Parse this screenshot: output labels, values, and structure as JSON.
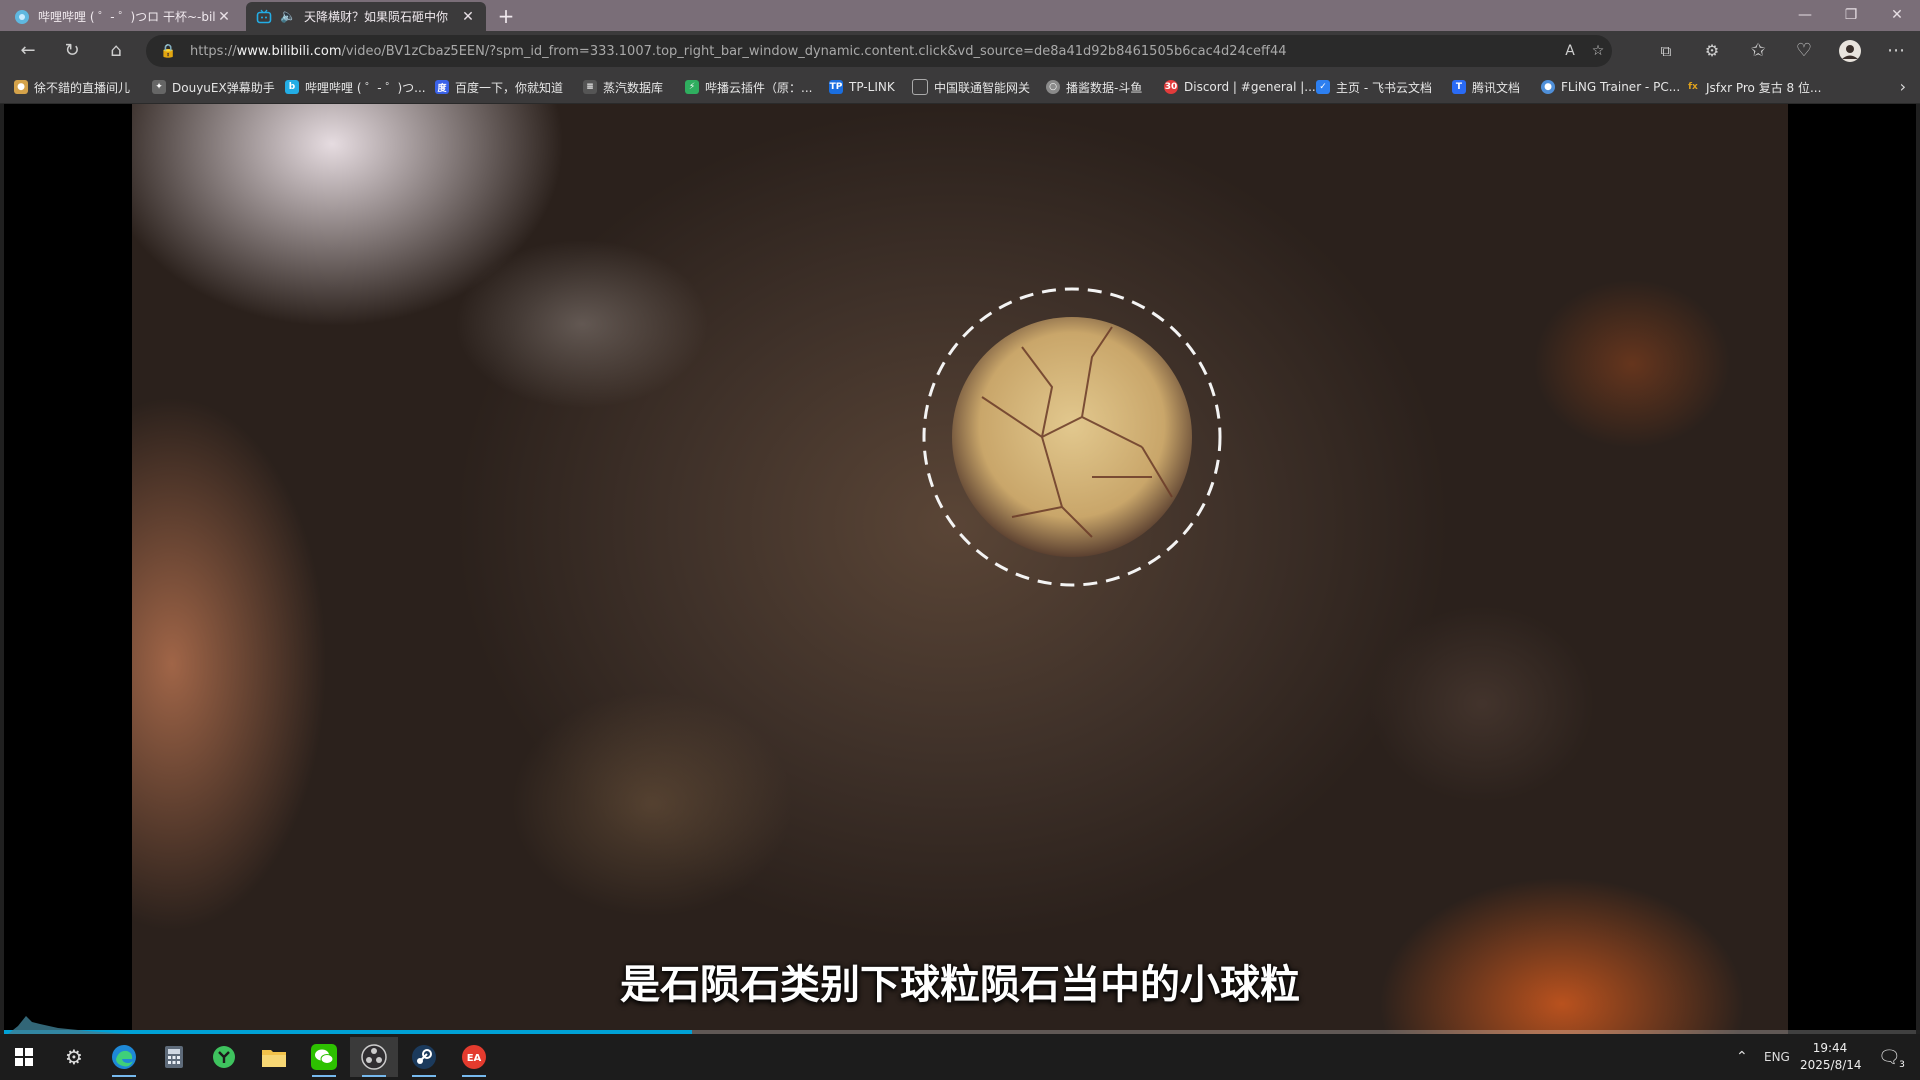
{
  "browser": {
    "tabs": [
      {
        "label": "哔哩哔哩 ( ゜- ゜)つロ 干杯~-bili",
        "active": false
      },
      {
        "label": "天降横财？如果陨石砸中你",
        "active": true
      }
    ],
    "url_prefix": "https://",
    "url_domain": "www.bilibili.com",
    "url_rest": "/video/BV1zCbaz5EEN/?spm_id_from=333.1007.top_right_bar_window_dynamic.content.click&vd_source=de8a41d92b8461505b6cac4d24ceff44"
  },
  "bookmarks": [
    {
      "label": "徐不錯的直播间儿",
      "icon": "avatar-icon",
      "color": "#d4a24a"
    },
    {
      "label": "DouyuEX弹幕助手",
      "icon": "puzzle-icon",
      "color": "#888888"
    },
    {
      "label": "哔哩哔哩 ( ゜- ゜)つ...",
      "icon": "bilibili-icon",
      "color": "#23ade5"
    },
    {
      "label": "百度一下，你就知道",
      "icon": "baidu-icon",
      "color": "#3a62e8"
    },
    {
      "label": "蒸汽数据库",
      "icon": "steamdb-icon",
      "color": "#555555"
    },
    {
      "label": "哔播云插件（原：...",
      "icon": "plugin-icon",
      "color": "#2fae5f"
    },
    {
      "label": "TP-LINK",
      "icon": "tplink-icon",
      "color": "#1a6ee0"
    },
    {
      "label": "中国联通智能网关",
      "icon": "page-icon",
      "color": "#666666"
    },
    {
      "label": "播酱数据-斗鱼",
      "icon": "data-icon",
      "color": "#8a8a8a"
    },
    {
      "label": "Discord | #general |...",
      "icon": "discord-icon",
      "color": "#e23b3b"
    },
    {
      "label": "主页 - 飞书云文档",
      "icon": "feishu-icon",
      "color": "#2d7ff0"
    },
    {
      "label": "腾讯文档",
      "icon": "tencent-doc-icon",
      "color": "#2a6bf5"
    },
    {
      "label": "FLiNG Trainer - PC...",
      "icon": "fling-icon",
      "color": "#4f8fd8"
    },
    {
      "label": "Jsfxr Pro 复古 8 位...",
      "icon": "jsfxr-icon",
      "color": "#e0a21c"
    }
  ],
  "video": {
    "subtitle": "是石陨石类别下球粒陨石当中的小球粒",
    "progress": 0.36
  },
  "taskbar": {
    "apps": [
      "windows-start-icon",
      "settings-icon",
      "edge-icon",
      "calculator-icon",
      "green-app-icon",
      "file-explorer-icon",
      "wechat-icon",
      "obs-icon",
      "steam-icon",
      "ea-icon"
    ],
    "lang": "ENG",
    "time": "19:44",
    "date": "2025/8/14",
    "notifications": "3"
  }
}
